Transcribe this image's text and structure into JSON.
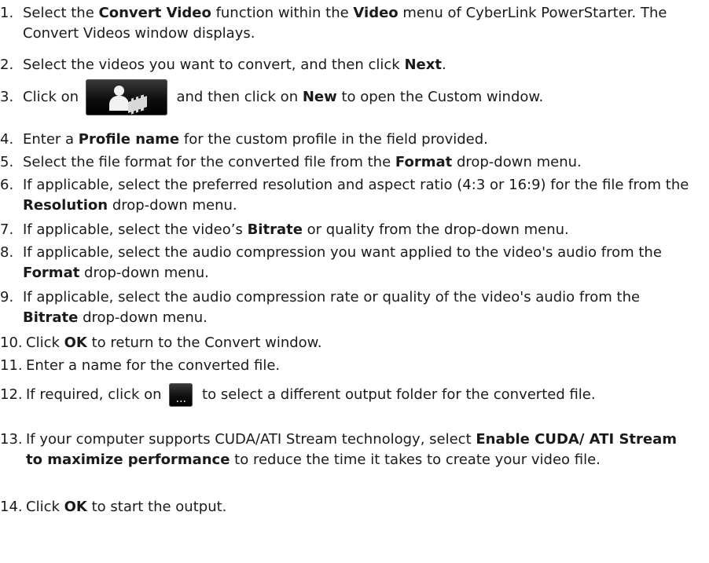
{
  "steps": [
    {
      "num": "1.",
      "parts": [
        {
          "t": "Select the "
        },
        {
          "t": "Convert Video",
          "b": true
        },
        {
          "t": " function within the "
        },
        {
          "t": "Video",
          "b": true
        },
        {
          "t": " menu of CyberLink PowerStarter. The Convert Videos window displays."
        }
      ]
    },
    {
      "num": "2.",
      "parts": [
        {
          "t": "Select the videos you want to convert, and then click "
        },
        {
          "t": "Next",
          "b": true
        },
        {
          "t": "."
        }
      ]
    },
    {
      "num": "3.",
      "parts": [
        {
          "t": "Click on "
        },
        {
          "icon": "profile-button"
        },
        {
          "t": " and then click on "
        },
        {
          "t": "New",
          "b": true
        },
        {
          "t": " to open the Custom window."
        }
      ]
    },
    {
      "num": "4.",
      "parts": [
        {
          "t": "Enter a "
        },
        {
          "t": "Profile name",
          "b": true
        },
        {
          "t": " for the custom profile in the field provided."
        }
      ]
    },
    {
      "num": "5.",
      "parts": [
        {
          "t": "Select the file format for the converted file from the "
        },
        {
          "t": "Format",
          "b": true
        },
        {
          "t": " drop-down menu."
        }
      ]
    },
    {
      "num": "6.",
      "parts": [
        {
          "t": "If applicable, select the preferred resolution and aspect ratio (4:3 or 16:9) for the file from the "
        },
        {
          "t": "Resolution",
          "b": true
        },
        {
          "t": " drop-down menu."
        }
      ]
    },
    {
      "num": "7.",
      "parts": [
        {
          "t": "If applicable, select the video’s "
        },
        {
          "t": "Bitrate",
          "b": true
        },
        {
          "t": " or quality from the drop-down menu."
        }
      ]
    },
    {
      "num": "8.",
      "parts": [
        {
          "t": "If applicable, select the audio compression you want applied to the video's audio from the "
        },
        {
          "t": "Format",
          "b": true
        },
        {
          "t": " drop-down menu."
        }
      ]
    },
    {
      "num": "9.",
      "parts": [
        {
          "t": "If applicable, select the audio compression rate or quality of the video's audio from the "
        },
        {
          "t": "Bitrate",
          "b": true
        },
        {
          "t": " drop-down menu."
        }
      ]
    },
    {
      "num": "10.",
      "parts": [
        {
          "t": "Click "
        },
        {
          "t": "OK",
          "b": true
        },
        {
          "t": " to return to the Convert window."
        }
      ]
    },
    {
      "num": "11.",
      "parts": [
        {
          "t": "Enter a name for the converted file."
        }
      ]
    },
    {
      "num": "12.",
      "parts": [
        {
          "t": "If required, click on "
        },
        {
          "icon": "browse-folder-button"
        },
        {
          "t": " to select a different output folder for the converted file."
        }
      ]
    },
    {
      "num": "13.",
      "parts": [
        {
          "t": "If your computer supports CUDA/ATI Stream technology, select "
        },
        {
          "t": "Enable CUDA/ ATI Stream to maximize performance",
          "b": true
        },
        {
          "t": " to reduce the time it takes to create your video file."
        }
      ]
    },
    {
      "num": "14.",
      "parts": [
        {
          "t": "Click "
        },
        {
          "t": "OK",
          "b": true
        },
        {
          "t": " to start the output."
        }
      ]
    }
  ],
  "icons": {
    "profile-button": {
      "name": "profile-video-icon",
      "colors": {
        "bg": "#000000",
        "fg": "#f2f2f2"
      }
    },
    "browse-folder-button": {
      "name": "browse-ellipsis-icon",
      "glyph": "...",
      "colors": {
        "bg": "#000000",
        "fg": "#ffffff"
      }
    }
  }
}
